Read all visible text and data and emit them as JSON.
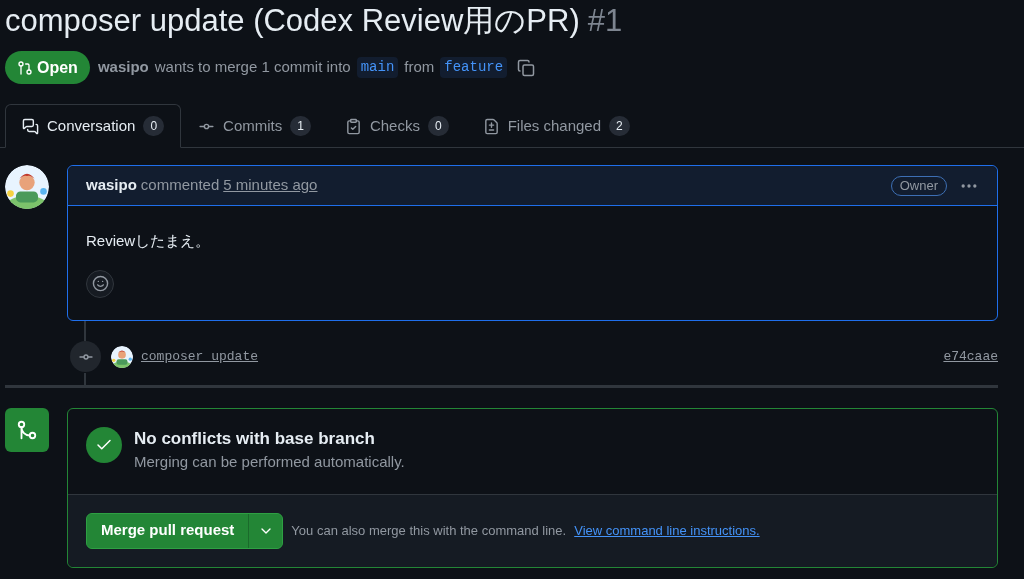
{
  "title": {
    "text": "composer update (Codex Review用のPR)",
    "number": "#1"
  },
  "status": {
    "state": "Open",
    "author": "wasipo",
    "text": "wants to merge 1 commit into",
    "base": "main",
    "from": "from",
    "head": "feature"
  },
  "tabs": [
    {
      "label": "Conversation",
      "count": "0",
      "kind": "conversation",
      "selected": true
    },
    {
      "label": "Commits",
      "count": "1",
      "kind": "commits",
      "selected": false
    },
    {
      "label": "Checks",
      "count": "0",
      "kind": "checks",
      "selected": false
    },
    {
      "label": "Files changed",
      "count": "2",
      "kind": "files",
      "selected": false
    }
  ],
  "comment": {
    "author": "wasipo",
    "action": "commented",
    "time": "5 minutes ago",
    "badge": "Owner",
    "body": "Reviewしたまえ。"
  },
  "commit": {
    "message": "composer update",
    "sha": "e74caae"
  },
  "merge": {
    "title": "No conflicts with base branch",
    "subtitle": "Merging can be performed automatically.",
    "button": "Merge pull request",
    "hint": "You can also merge this with the command line.",
    "link": "View command line instructions."
  }
}
